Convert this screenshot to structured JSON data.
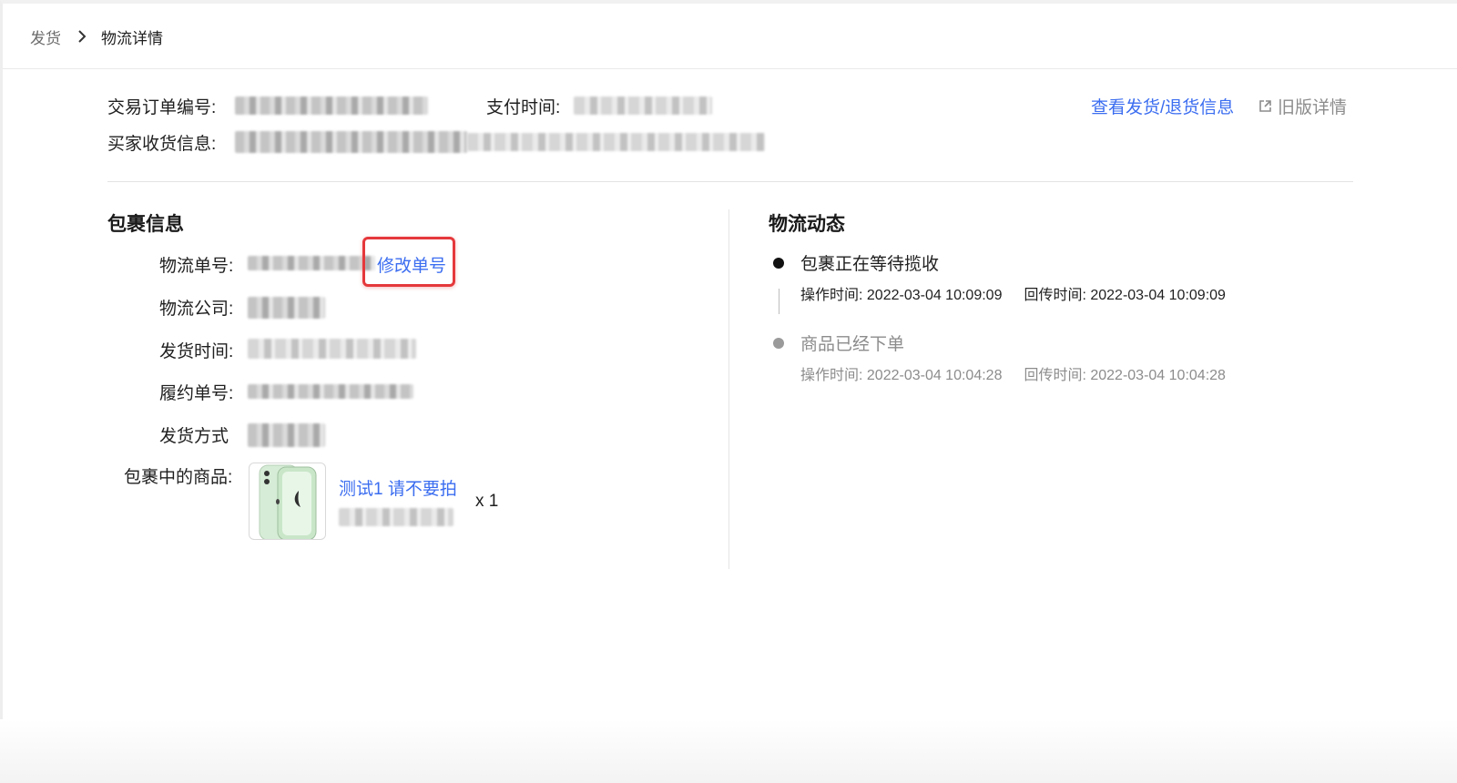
{
  "breadcrumb": {
    "parent": "发货",
    "current": "物流详情"
  },
  "order": {
    "trade_no_label": "交易订单编号:",
    "pay_time_label": "支付时间:",
    "buyer_info_label": "买家收货信息:",
    "view_shipping_return_link": "查看发货/退货信息",
    "old_detail_link": "旧版详情"
  },
  "package": {
    "title": "包裹信息",
    "tracking_no_label": "物流单号:",
    "edit_tracking_no": "修改单号",
    "company_label": "物流公司:",
    "ship_time_label": "发货时间:",
    "fulfillment_no_label": "履约单号:",
    "ship_method_label": "发货方式",
    "items_label": "包裹中的商品:",
    "product_name": "测试1 请不要拍",
    "quantity": "x 1"
  },
  "logistics": {
    "title": "物流动态",
    "events": [
      {
        "status": "包裹正在等待揽收",
        "op_time": "操作时间: 2022-03-04 10:09:09",
        "callback_time": "回传时间: 2022-03-04 10:09:09",
        "active": true
      },
      {
        "status": "商品已经下单",
        "op_time": "操作时间: 2022-03-04 10:04:28",
        "callback_time": "回传时间: 2022-03-04 10:04:28",
        "active": false
      }
    ]
  },
  "colors": {
    "link": "#3b6df0",
    "highlight": "#e5383b",
    "active_dot": "#111111",
    "inactive_dot": "#9a9a9a"
  },
  "icons": {
    "separator": "chevron-right-icon",
    "external": "external-link-icon"
  }
}
